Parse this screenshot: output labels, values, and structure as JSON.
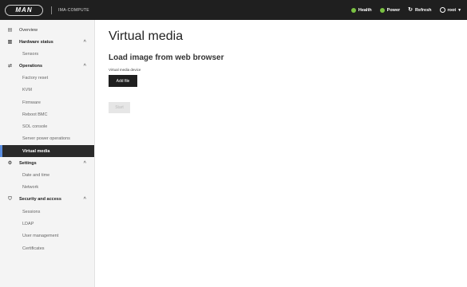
{
  "header": {
    "logo_text": "MAN",
    "hostname": "IMA-COMPUTE",
    "health_label": "Health",
    "power_label": "Power",
    "refresh_label": "Refresh",
    "user_label": "root",
    "status_color": "#7ac142"
  },
  "sidebar": {
    "items": [
      {
        "label": "Overview",
        "icon": "grid-icon"
      },
      {
        "label": "Hardware status",
        "icon": "server-icon",
        "children": [
          "Sensors"
        ]
      },
      {
        "label": "Operations",
        "icon": "arrows-icon",
        "children": [
          "Factory reset",
          "KVM",
          "Firmware",
          "Reboot BMC",
          "SOL console",
          "Server power operations",
          "Virtual media"
        ]
      },
      {
        "label": "Settings",
        "icon": "gear-icon",
        "children": [
          "Date and time",
          "Network"
        ]
      },
      {
        "label": "Security and access",
        "icon": "shield-icon",
        "children": [
          "Sessions",
          "LDAP",
          "User management",
          "Certificates"
        ]
      }
    ],
    "active_item": "Virtual media"
  },
  "main": {
    "title": "Virtual media",
    "section_title": "Load image from web browser",
    "device_label": "Virtual media device",
    "add_file_label": "Add file",
    "start_label": "Start"
  }
}
